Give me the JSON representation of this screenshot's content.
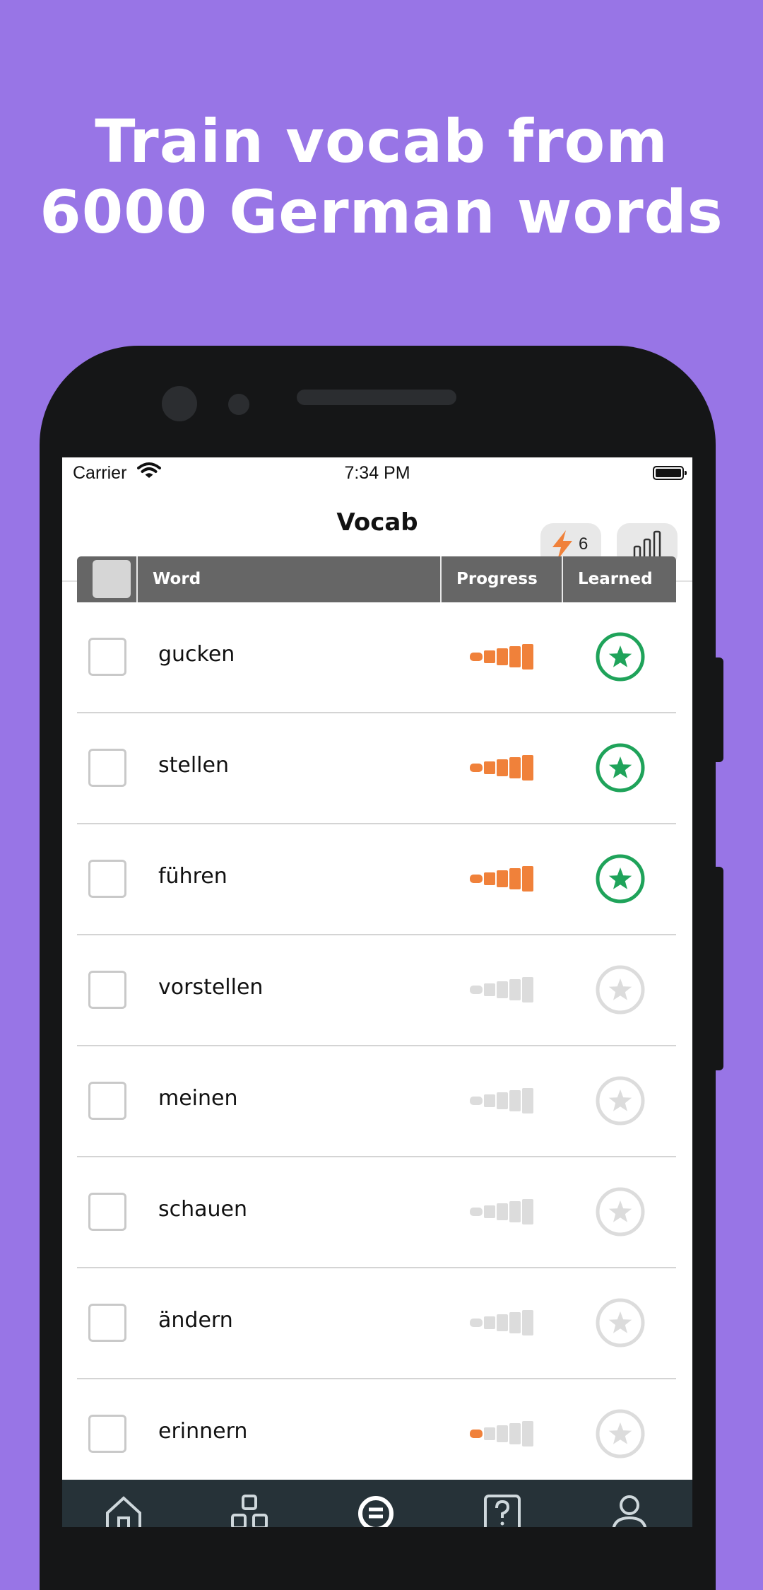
{
  "promo": {
    "line1": "Train vocab from",
    "line2": "6000 German words"
  },
  "status_bar": {
    "carrier": "Carrier",
    "time": "7:34 PM"
  },
  "nav": {
    "title": "Vocab",
    "streak_count": "6"
  },
  "table": {
    "headers": {
      "word": "Word",
      "progress": "Progress",
      "learned": "Learned"
    },
    "rows": [
      {
        "word": "gucken",
        "progress": 5,
        "learned": true
      },
      {
        "word": "stellen",
        "progress": 5,
        "learned": true
      },
      {
        "word": "führen",
        "progress": 5,
        "learned": true
      },
      {
        "word": "vorstellen",
        "progress": 0,
        "learned": false
      },
      {
        "word": "meinen",
        "progress": 0,
        "learned": false
      },
      {
        "word": "schauen",
        "progress": 0,
        "learned": false
      },
      {
        "word": "ändern",
        "progress": 0,
        "learned": false
      },
      {
        "word": "erinnern",
        "progress": 1,
        "learned": false
      }
    ],
    "progress_max": 5
  },
  "colors": {
    "background": "#9875e6",
    "progress_active": "#f0813a",
    "progress_inactive": "#dcdcdc",
    "learned": "#1fa35a",
    "not_learned": "#dcdcdc",
    "header": "#666666",
    "tabbar": "#263238"
  },
  "icons": {
    "streak": "lightning-icon",
    "stats": "bar-chart-icon",
    "learned": "star-circle-icon",
    "tabs": [
      "home-icon",
      "categories-icon",
      "vocab-icon",
      "quiz-icon",
      "profile-icon"
    ]
  }
}
